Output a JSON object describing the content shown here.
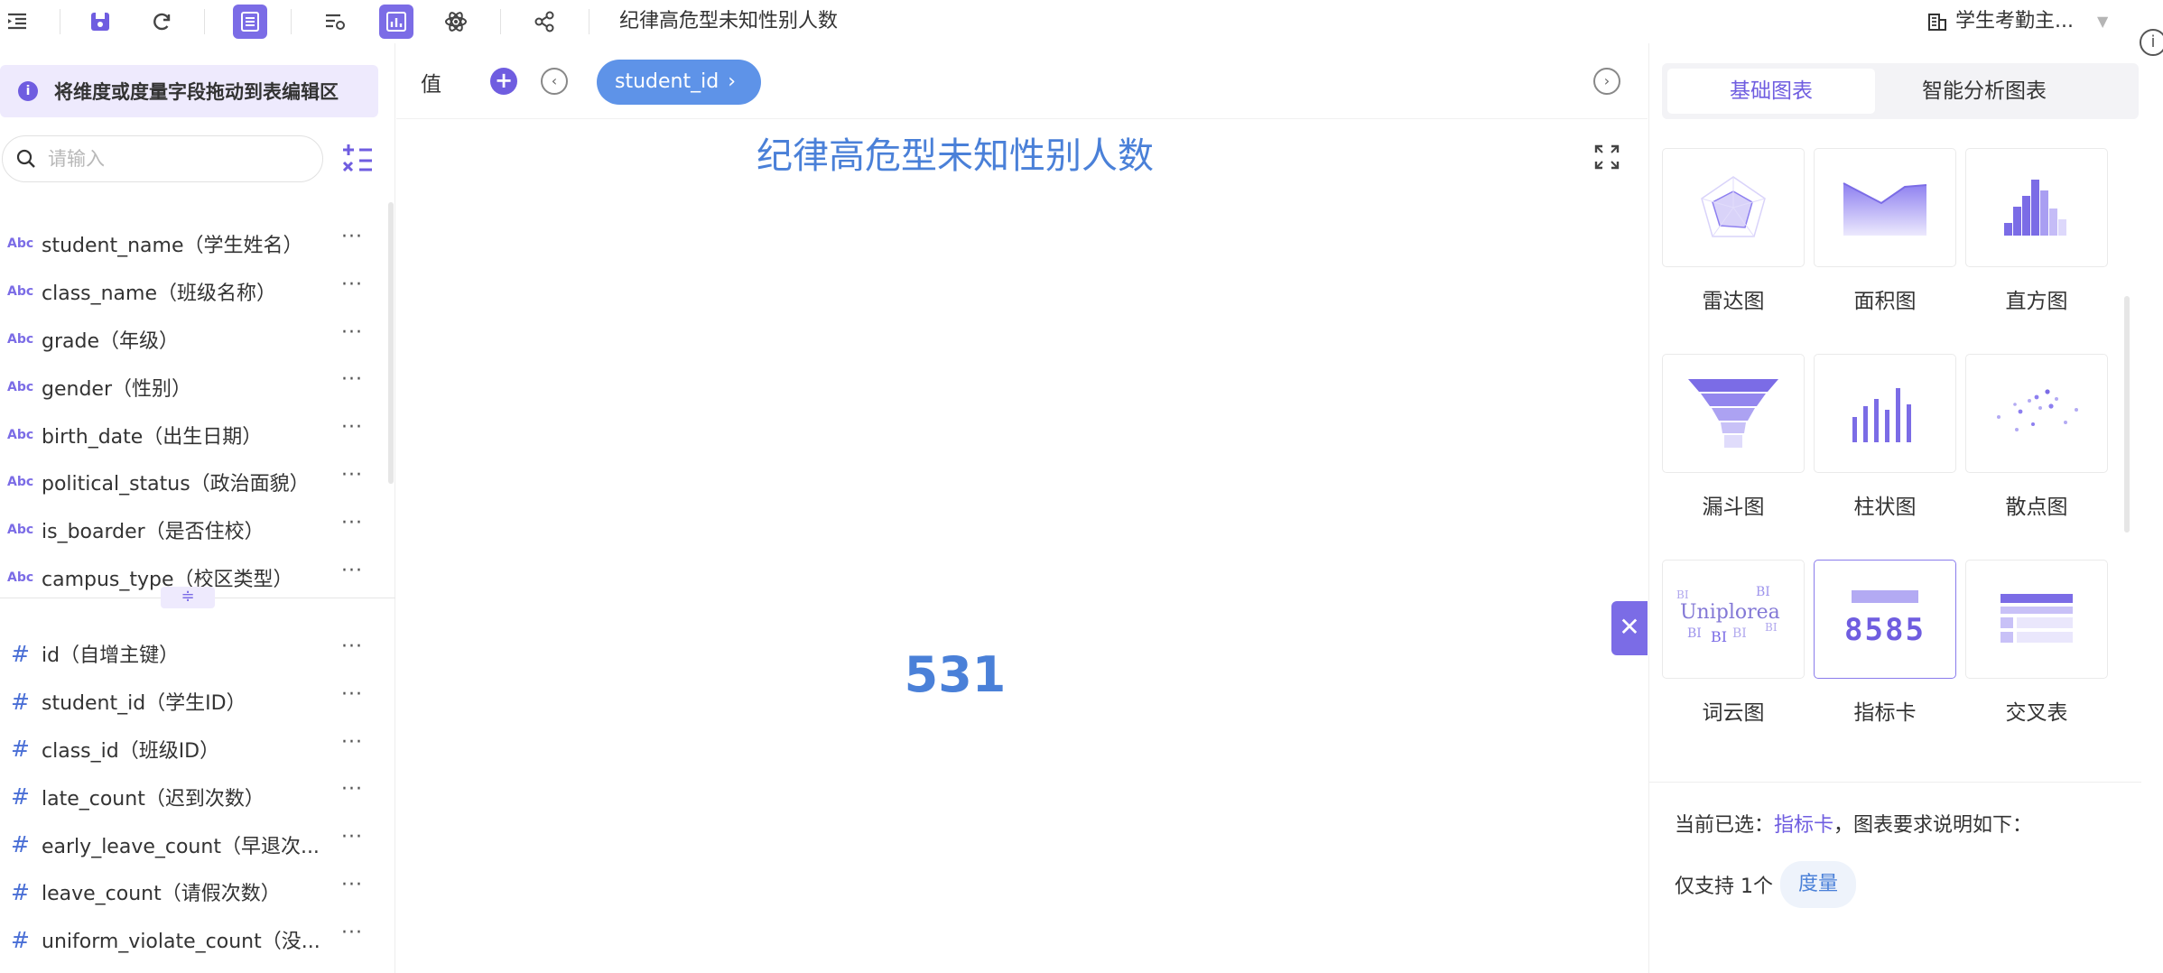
{
  "toolbar": {
    "title": "纪律高危型未知性别人数",
    "dataset": "学生考勤主...",
    "dataset_icon": "building-icon",
    "info_glyph": "i"
  },
  "fields_panel": {
    "hint": "将维度或度量字段拖动到表编辑区",
    "hint_glyph": "i",
    "search_placeholder": "请输入",
    "divider_glyph": "≑",
    "dimension_type_label": "Abc",
    "measure_type_label": "#",
    "more_glyph": "···",
    "dimensions": [
      {
        "label": "student_name（学生姓名）"
      },
      {
        "label": "class_name（班级名称）"
      },
      {
        "label": "grade（年级）"
      },
      {
        "label": "gender（性别）"
      },
      {
        "label": "birth_date（出生日期）"
      },
      {
        "label": "political_status（政治面貌）"
      },
      {
        "label": "is_boarder（是否住校）"
      },
      {
        "label": "campus_type（校区类型）"
      }
    ],
    "measures": [
      {
        "label": "id（自增主键）"
      },
      {
        "label": "student_id（学生ID）"
      },
      {
        "label": "class_id（班级ID）"
      },
      {
        "label": "late_count（迟到次数）"
      },
      {
        "label": "early_leave_count（早退次..."
      },
      {
        "label": "leave_count（请假次数）"
      },
      {
        "label": "uniform_violate_count（没..."
      }
    ]
  },
  "editor": {
    "value_label": "值",
    "add_glyph": "+",
    "prev_glyph": "‹",
    "next_glyph": "›",
    "chip_label": "student_id",
    "chip_glyph": "›",
    "chart_title": "纪律高危型未知性别人数",
    "kpi_value": "531",
    "close_glyph": "✕"
  },
  "chart_types": {
    "tabs": [
      {
        "label": "基础图表",
        "active": true
      },
      {
        "label": "智能分析图表",
        "active": false
      }
    ],
    "items": [
      {
        "label": "雷达图",
        "icon": "radar-chart-icon"
      },
      {
        "label": "面积图",
        "icon": "area-chart-icon"
      },
      {
        "label": "直方图",
        "icon": "histogram-icon"
      },
      {
        "label": "漏斗图",
        "icon": "funnel-chart-icon"
      },
      {
        "label": "柱状图",
        "icon": "bar-chart-icon"
      },
      {
        "label": "散点图",
        "icon": "scatter-chart-icon"
      },
      {
        "label": "词云图",
        "icon": "word-cloud-icon"
      },
      {
        "label": "指标卡",
        "icon": "kpi-card-icon",
        "selected": true
      },
      {
        "label": "交叉表",
        "icon": "cross-table-icon"
      }
    ],
    "kpi_preview_text": "8585",
    "wordcloud_preview_text": "Uniplorea",
    "wordcloud_small_text": "BI",
    "description_prefix": "当前已选：",
    "description_selected": "指标卡",
    "description_suffix": "，图表要求说明如下：",
    "support_prefix": "仅支持 1个",
    "support_pill": "度量"
  },
  "colors": {
    "accent": "#6f5de0",
    "chart_blue": "#4a80d8",
    "chip_blue": "#5e93e8"
  }
}
